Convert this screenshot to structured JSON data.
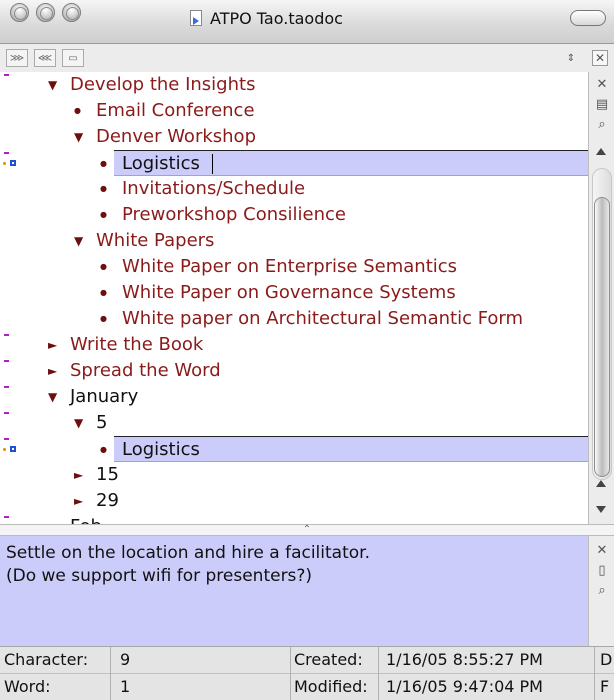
{
  "window": {
    "title": "ATPO Tao.taodoc"
  },
  "outline": {
    "rows": [
      {
        "label": "Develop the Insights",
        "depth": 0,
        "marker": "open"
      },
      {
        "label": "Email Conference",
        "depth": 1,
        "marker": "bullet"
      },
      {
        "label": "Denver Workshop",
        "depth": 1,
        "marker": "open"
      },
      {
        "label": "Logistics",
        "depth": 2,
        "marker": "bullet",
        "selected": true
      },
      {
        "label": "Invitations/Schedule",
        "depth": 2,
        "marker": "bullet"
      },
      {
        "label": "Preworkshop Consilience",
        "depth": 2,
        "marker": "bullet"
      },
      {
        "label": "White Papers",
        "depth": 1,
        "marker": "open"
      },
      {
        "label": "White Paper on Enterprise Semantics",
        "depth": 2,
        "marker": "bullet"
      },
      {
        "label": "White Paper on Governance Systems",
        "depth": 2,
        "marker": "bullet"
      },
      {
        "label": "White paper on Architectural Semantic Form",
        "depth": 2,
        "marker": "bullet"
      },
      {
        "label": "Write the Book",
        "depth": 0,
        "marker": "closed"
      },
      {
        "label": "Spread the Word",
        "depth": 0,
        "marker": "closed"
      },
      {
        "label": "January",
        "depth": 0,
        "marker": "open",
        "plain": true
      },
      {
        "label": "5",
        "depth": 1,
        "marker": "open",
        "plain": true
      },
      {
        "label": "Logistics",
        "depth": 2,
        "marker": "bullet",
        "plain": true,
        "selected": true
      },
      {
        "label": "15",
        "depth": 1,
        "marker": "closed",
        "plain": true
      },
      {
        "label": "29",
        "depth": 1,
        "marker": "closed",
        "plain": true
      },
      {
        "label": "Feb",
        "depth": 0,
        "marker": "closed",
        "plain": true
      }
    ]
  },
  "note": {
    "line1": "Settle on the location and hire a facilitator.",
    "line2": "(Do we support wifi for presenters?)"
  },
  "status": {
    "character_label": "Character:",
    "character_value": "9",
    "word_label": "Word:",
    "word_value": "1",
    "created_label": "Created:",
    "created_value": "1/16/05 8:55:27 PM",
    "modified_label": "Modified:",
    "modified_value": "1/16/05 9:47:04 PM",
    "extra_1": "D",
    "extra_2": "F"
  },
  "colors": {
    "item_red": "#8b1a1a",
    "selection": "#ccccfb",
    "note_bg": "#ccccfb"
  }
}
